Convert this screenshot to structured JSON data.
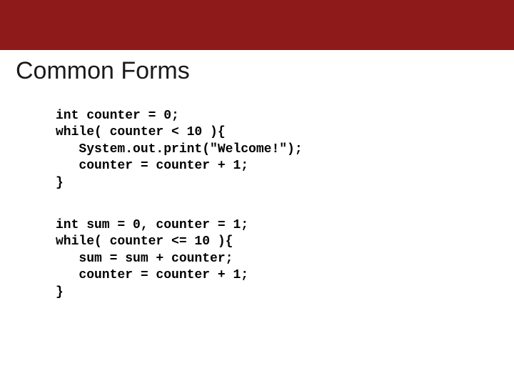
{
  "title": "Common Forms",
  "code1": "int counter = 0;\nwhile( counter < 10 ){\n   System.out.print(\"Welcome!\");\n   counter = counter + 1;\n}",
  "code2": "int sum = 0, counter = 1;\nwhile( counter <= 10 ){\n   sum = sum + counter;\n   counter = counter + 1;\n}"
}
